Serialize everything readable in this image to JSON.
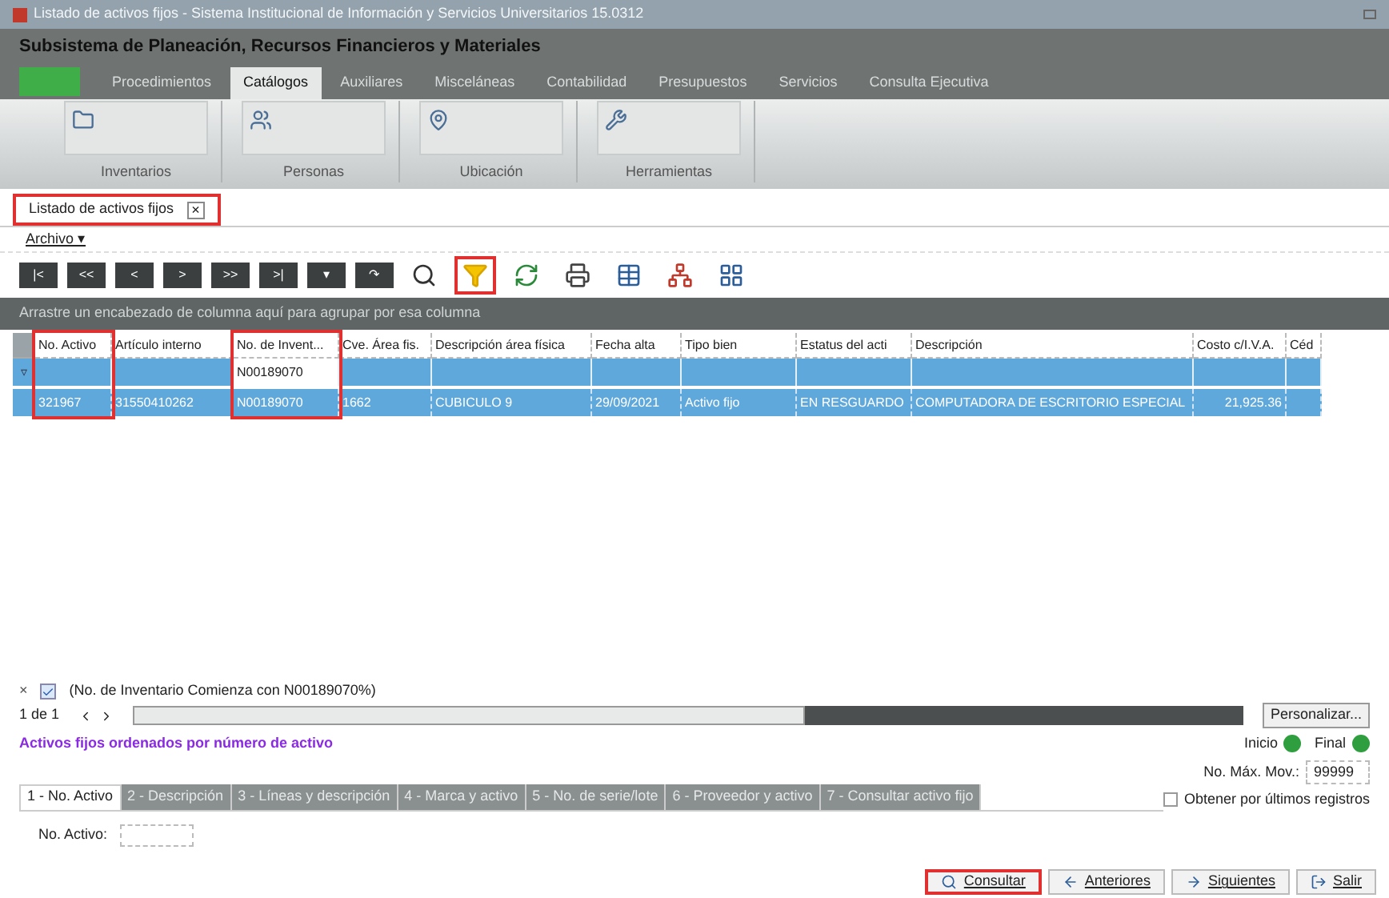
{
  "window": {
    "title": "Listado de activos fijos - Sistema Institucional de Información y Servicios Universitarios 15.0312"
  },
  "subsystem": {
    "title": "Subsistema de Planeación, Recursos Financieros y Materiales"
  },
  "menu_tabs": [
    {
      "label": "Procedimientos",
      "selected": false
    },
    {
      "label": "Catálogos",
      "selected": true
    },
    {
      "label": "Auxiliares",
      "selected": false
    },
    {
      "label": "Misceláneas",
      "selected": false
    },
    {
      "label": "Contabilidad",
      "selected": false
    },
    {
      "label": "Presupuestos",
      "selected": false
    },
    {
      "label": "Servicios",
      "selected": false
    },
    {
      "label": "Consulta Ejecutiva",
      "selected": false
    }
  ],
  "ribbon_groups": [
    {
      "label": "Inventarios"
    },
    {
      "label": "Personas"
    },
    {
      "label": "Ubicación"
    },
    {
      "label": "Herramientas"
    }
  ],
  "document_tab": {
    "label": "Listado de activos fijos",
    "close": "×",
    "annotated": true
  },
  "file_menu": "Archivo ▾",
  "toolbar": {
    "nav_buttons": [
      "|<",
      "<<",
      "<",
      ">",
      ">>",
      ">|",
      "▾",
      "↷"
    ],
    "icon_buttons": [
      {
        "annotated": false
      },
      {
        "annotated": true
      },
      {
        "annotated": false
      },
      {
        "annotated": false
      },
      {
        "annotated": false
      },
      {
        "annotated": false
      },
      {
        "annotated": false
      }
    ]
  },
  "group_panel": "Arrastre un encabezado de columna aquí para agrupar por esa columna",
  "table": {
    "columns": [
      {
        "label": "No. Activo",
        "annotated": true
      },
      {
        "label": "Artículo interno",
        "annotated": false
      },
      {
        "label": "No. de Invent...",
        "annotated": true
      },
      {
        "label": "Cve. Área fis.",
        "annotated": false
      },
      {
        "label": "Descripción área física",
        "annotated": false
      },
      {
        "label": "Fecha alta",
        "annotated": false
      },
      {
        "label": "Tipo bien",
        "annotated": false
      },
      {
        "label": "Estatus del acti",
        "annotated": false
      },
      {
        "label": "Descripción",
        "annotated": false
      },
      {
        "label": "Costo c/I.V.A.",
        "annotated": false
      },
      {
        "label": "Céd",
        "annotated": false
      }
    ],
    "filter_row": {
      "marker": "▿",
      "cells": [
        "",
        "",
        "N00189070",
        "",
        "",
        "",
        "",
        "",
        "",
        "",
        ""
      ]
    },
    "rows": [
      {
        "selected": true,
        "cells": [
          "321967",
          "31550410262",
          "N00189070",
          "1662",
          "CUBICULO 9",
          "29/09/2021",
          "Activo fijo",
          "EN RESGUARDO",
          "COMPUTADORA DE ESCRITORIO ESPECIAL",
          "21,925.36",
          ""
        ]
      }
    ]
  },
  "filter_bar": {
    "close": "×",
    "checked": true,
    "text": "(No. de Inventario Comienza con N00189070%)"
  },
  "pager": {
    "text": "1 de 1",
    "customize": "Personalizar..."
  },
  "order_note": "Activos fijos ordenados por número de activo",
  "indicators": [
    {
      "label": "Inicio",
      "color": "#2e9e3e"
    },
    {
      "label": "Final",
      "color": "#2e9e3e"
    }
  ],
  "max_moves": {
    "label": "No. Máx. Mov.:",
    "value": "99999"
  },
  "last_records": {
    "label": "Obtener por últimos registros",
    "checked": false
  },
  "search_tabs": [
    {
      "label": "1 - No. Activo",
      "selected": true
    },
    {
      "label": "2 - Descripción",
      "selected": false
    },
    {
      "label": "3 - Líneas y descripción",
      "selected": false
    },
    {
      "label": "4 - Marca y activo",
      "selected": false
    },
    {
      "label": "5 - No. de serie/lote",
      "selected": false
    },
    {
      "label": "6 - Proveedor y activo",
      "selected": false
    },
    {
      "label": "7 - Consultar activo fijo",
      "selected": false
    }
  ],
  "search_field": {
    "label": "No. Activo:"
  },
  "buttons": [
    {
      "label": "Consultar",
      "annotated": true
    },
    {
      "label": "Anteriores",
      "annotated": false
    },
    {
      "label": "Siguientes",
      "annotated": false
    },
    {
      "label": "Salir",
      "annotated": false
    }
  ]
}
